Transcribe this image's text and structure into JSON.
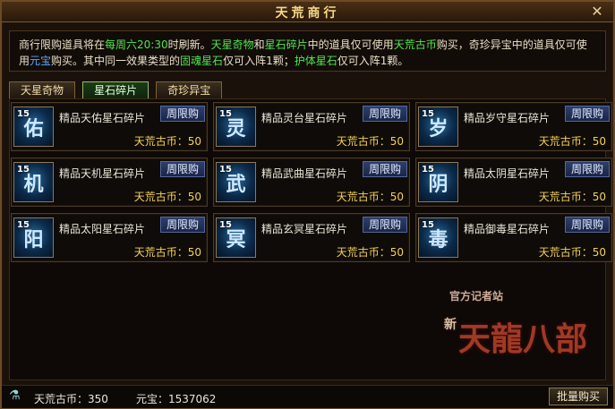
{
  "window": {
    "title": "天荒商行",
    "close_icon": "close-icon"
  },
  "notice": {
    "parts": [
      {
        "text": "商行限购道具将在",
        "color": ""
      },
      {
        "text": "每周六20:30",
        "color": "green"
      },
      {
        "text": "时刷新。",
        "color": ""
      },
      {
        "text": "天星奇物",
        "color": "green"
      },
      {
        "text": "和",
        "color": ""
      },
      {
        "text": "星石碎片",
        "color": "green"
      },
      {
        "text": "中的道具仅可使用",
        "color": ""
      },
      {
        "text": "天荒古币",
        "color": "green"
      },
      {
        "text": "购买，奇珍异宝中的道具仅可使用",
        "color": ""
      },
      {
        "text": "元宝",
        "color": "blue"
      },
      {
        "text": "购买。其中同一效果类型的",
        "color": ""
      },
      {
        "text": "固魂星石",
        "color": "green"
      },
      {
        "text": "仅可入阵1颗；",
        "color": ""
      },
      {
        "text": "护体星石",
        "color": "green"
      },
      {
        "text": "仅可入阵1颗。",
        "color": ""
      }
    ]
  },
  "tabs": [
    {
      "label": "天星奇物"
    },
    {
      "label": "星石碎片",
      "active": true
    },
    {
      "label": "奇珍异宝"
    }
  ],
  "items": [
    {
      "level": "15",
      "glyph": "佑",
      "name": "精品天佑星石碎片",
      "badge": "周限购",
      "price": "天荒古币：50"
    },
    {
      "level": "15",
      "glyph": "灵",
      "name": "精品灵台星石碎片",
      "badge": "周限购",
      "price": "天荒古币：50"
    },
    {
      "level": "15",
      "glyph": "岁",
      "name": "精品岁守星石碎片",
      "badge": "周限购",
      "price": "天荒古币：50"
    },
    {
      "level": "15",
      "glyph": "机",
      "name": "精品天机星石碎片",
      "badge": "周限购",
      "price": "天荒古币：50"
    },
    {
      "level": "15",
      "glyph": "武",
      "name": "精品武曲星石碎片",
      "badge": "周限购",
      "price": "天荒古币：50"
    },
    {
      "level": "15",
      "glyph": "阴",
      "name": "精品太阴星石碎片",
      "badge": "周限购",
      "price": "天荒古币：50"
    },
    {
      "level": "15",
      "glyph": "阳",
      "name": "精品太阳星石碎片",
      "badge": "周限购",
      "price": "天荒古币：50"
    },
    {
      "level": "15",
      "glyph": "冥",
      "name": "精品玄冥星石碎片",
      "badge": "周限购",
      "price": "天荒古币：50"
    },
    {
      "level": "15",
      "glyph": "毒",
      "name": "精品御毒星石碎片",
      "badge": "周限购",
      "price": "天荒古币：50"
    }
  ],
  "footer": {
    "coins_label": "天荒古币：350",
    "yuanbao_label": "元宝：1537062",
    "buy_button": "批量购买"
  },
  "logo": {
    "caption": "官方记者站",
    "new_label": "新",
    "title": "天龍八部"
  }
}
